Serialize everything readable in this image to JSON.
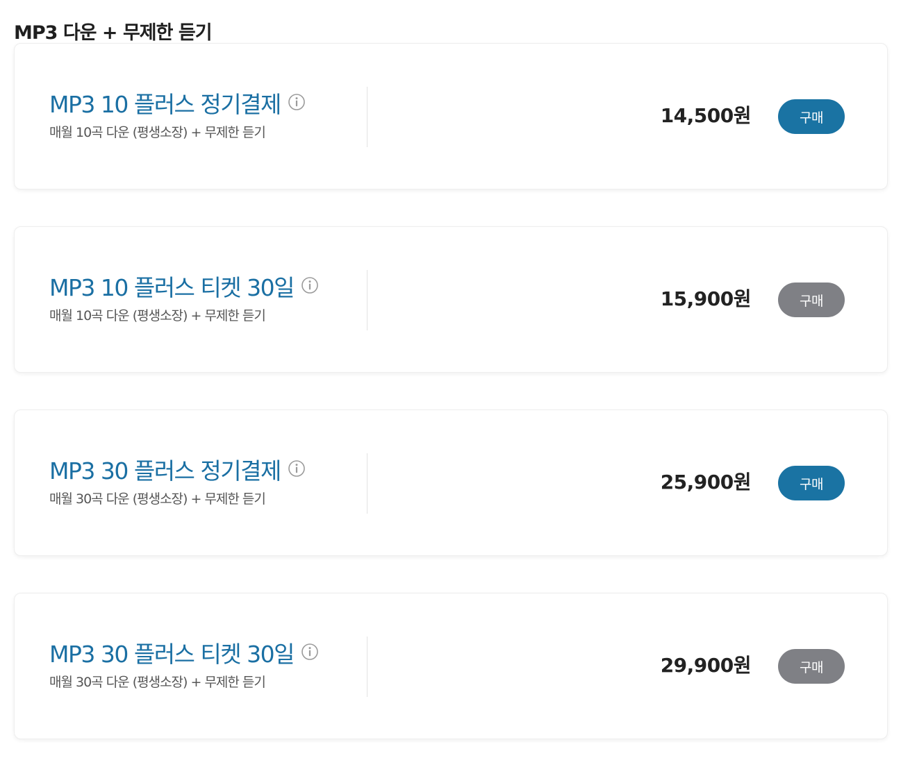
{
  "section": {
    "title": "MP3 다운 + 무제한 듣기"
  },
  "plans": [
    {
      "name": "MP3 10 플러스 정기결제",
      "description": "매월 10곡 다운 (평생소장) + 무제한 듣기",
      "price": "14,500원",
      "button_label": "구매",
      "button_state": "active",
      "info_icon": "info-circle-icon"
    },
    {
      "name": "MP3 10 플러스 티켓 30일",
      "description": "매월 10곡 다운 (평생소장) + 무제한 듣기",
      "price": "15,900원",
      "button_label": "구매",
      "button_state": "inactive",
      "info_icon": "info-circle-icon"
    },
    {
      "name": "MP3 30 플러스 정기결제",
      "description": "매월 30곡 다운 (평생소장) + 무제한 듣기",
      "price": "25,900원",
      "button_label": "구매",
      "button_state": "active",
      "info_icon": "info-circle-icon"
    },
    {
      "name": "MP3 30 플러스 티켓 30일",
      "description": "매월 30곡 다운 (평생소장) + 무제한 듣기",
      "price": "29,900원",
      "button_label": "구매",
      "button_state": "inactive",
      "info_icon": "info-circle-icon"
    }
  ],
  "colors": {
    "plan_name": "#1a6fa3",
    "button_active": "#1a73a3",
    "button_inactive": "#7f8085",
    "price": "#222222",
    "description": "#555555"
  }
}
